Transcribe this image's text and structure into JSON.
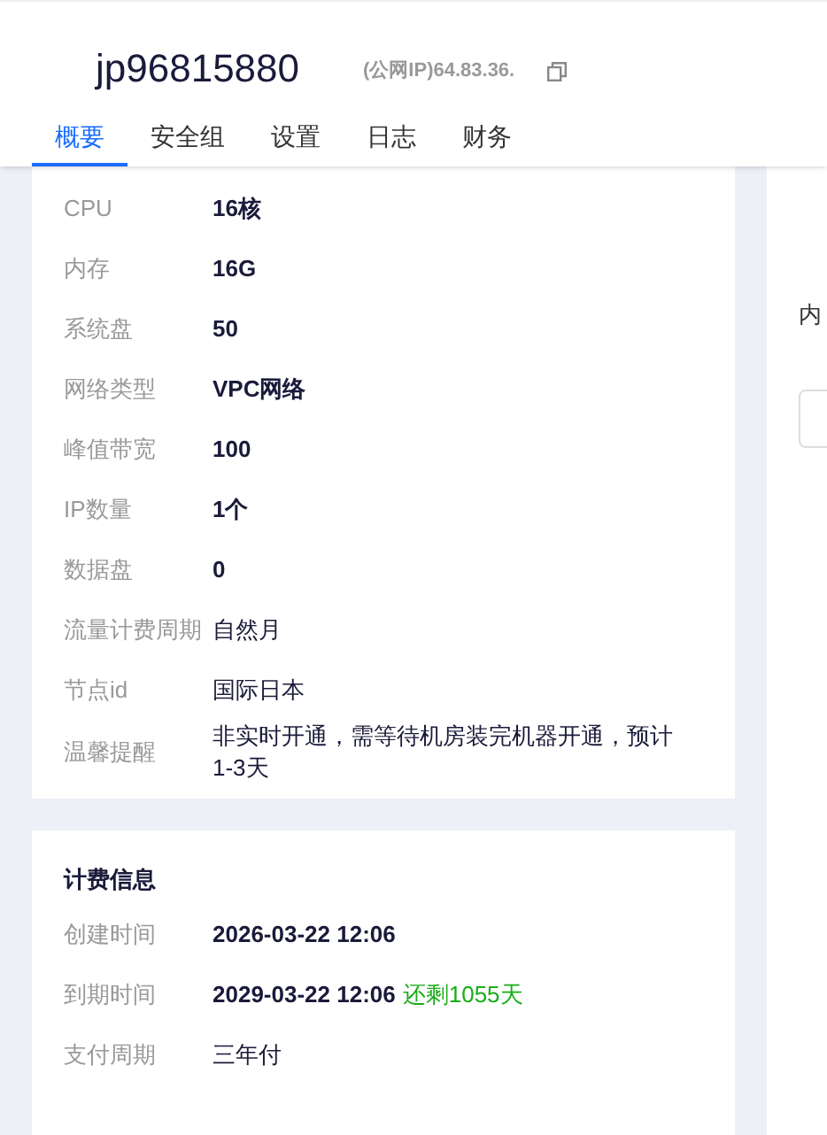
{
  "header": {
    "title": "jp96815880",
    "ip": "(公网IP)64.83.36."
  },
  "tabs": [
    {
      "label": "概要",
      "selected": true
    },
    {
      "label": "安全组",
      "selected": false
    },
    {
      "label": "设置",
      "selected": false
    },
    {
      "label": "日志",
      "selected": false
    },
    {
      "label": "财务",
      "selected": false
    }
  ],
  "specs": [
    {
      "label": "CPU",
      "value": "16核",
      "bold": true
    },
    {
      "label": "内存",
      "value": "16G",
      "bold": true
    },
    {
      "label": "系统盘",
      "value": "50",
      "bold": true
    },
    {
      "label": "网络类型",
      "value": "VPC网络",
      "bold": true
    },
    {
      "label": "峰值带宽",
      "value": "100",
      "bold": true
    },
    {
      "label": "IP数量",
      "value": "1个",
      "bold": true
    },
    {
      "label": "数据盘",
      "value": "0",
      "bold": true
    },
    {
      "label": "流量计费周期",
      "value": "自然月",
      "bold": false
    },
    {
      "label": "节点id",
      "value": "国际日本",
      "bold": false
    },
    {
      "label": "温馨提醒",
      "value": "非实时开通，需等待机房装完机器开通，预计1-3天",
      "bold": false
    }
  ],
  "billing": {
    "title": "计费信息",
    "rows": [
      {
        "label": "创建时间",
        "value": "2026-03-22 12:06",
        "bold": true
      },
      {
        "label": "到期时间",
        "value": "2029-03-22 12:06",
        "bold": true,
        "note": "还剩1055天"
      },
      {
        "label": "支付周期",
        "value": "三年付",
        "bold": false
      }
    ]
  },
  "side_panel": {
    "label": "内"
  }
}
